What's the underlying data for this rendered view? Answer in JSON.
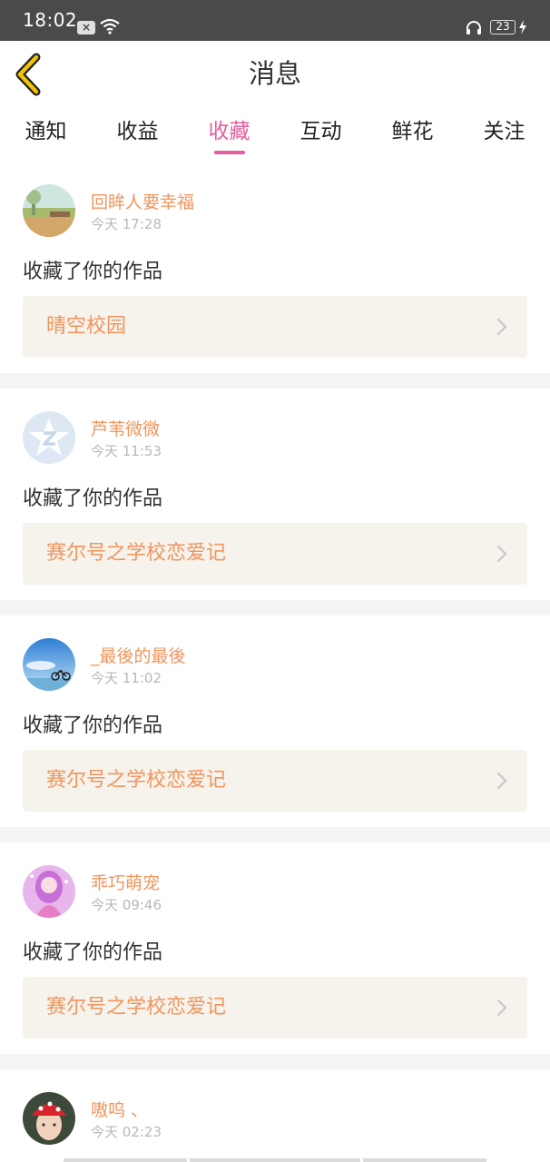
{
  "status_bar": {
    "time": "18:02",
    "notification_icon": "x-box-icon",
    "notification_icon_label": "×",
    "wifi_icon": "wifi-icon",
    "headset_icon": "headset-icon",
    "battery": "23",
    "charging_icon": "charging-bolt-icon"
  },
  "header": {
    "title": "消息",
    "back_icon": "chevron-left-icon",
    "accent_color": "#f5c400"
  },
  "tabs": [
    {
      "label": "通知",
      "active": false
    },
    {
      "label": "收益",
      "active": false
    },
    {
      "label": "收藏",
      "active": true
    },
    {
      "label": "互动",
      "active": false
    },
    {
      "label": "鲜花",
      "active": false
    },
    {
      "label": "关注",
      "active": false
    }
  ],
  "colors": {
    "active_tab": "#e55d9c",
    "username": "#f0955e",
    "work_title": "#f0955e",
    "time": "#b8b8b8",
    "card_link_bg": "#f5f3ec",
    "separator": "#f6f3f6"
  },
  "messages": [
    {
      "username": "回眸人要幸福",
      "time": "今天 17:28",
      "action": "收藏了你的作品",
      "work": "晴空校园",
      "avatar": "landscape-avatar"
    },
    {
      "username": "芦苇微微",
      "time": "今天 11:53",
      "action": "收藏了你的作品",
      "work": "赛尔号之学校恋爱记",
      "avatar": "default-avatar"
    },
    {
      "username": "_最後的最後",
      "time": "今天 11:02",
      "action": "收藏了你的作品",
      "work": "赛尔号之学校恋爱记",
      "avatar": "sky-bicycle-avatar"
    },
    {
      "username": "乖巧萌宠",
      "time": "今天 09:46",
      "action": "收藏了你的作品",
      "work": "赛尔号之学校恋爱记",
      "avatar": "pink-anime-avatar"
    },
    {
      "username": "嗷呜 、",
      "time": "今天 02:23",
      "action": "",
      "work": "",
      "avatar": "person-red-hat-avatar"
    }
  ]
}
